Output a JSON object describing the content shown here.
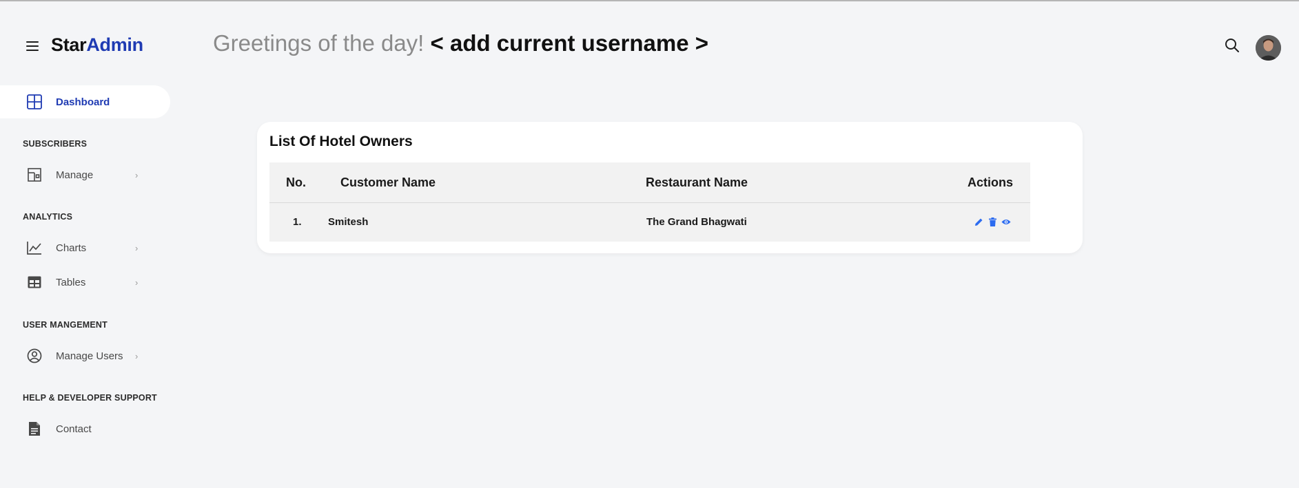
{
  "header": {
    "brand_part1": "Star",
    "brand_part2": "Admin",
    "greeting_prefix": "Greetings of the day!",
    "greeting_name": "< add current username >"
  },
  "sidebar": {
    "dashboard": "Dashboard",
    "sections": {
      "subscribers": "SUBSCRIBERS",
      "analytics": "ANALYTICS",
      "user_management": "USER MANGEMENT",
      "help": "HELP & DEVELOPER SUPPORT"
    },
    "items": {
      "manage": "Manage",
      "charts": "Charts",
      "tables": "Tables",
      "manage_users": "Manage Users",
      "contact": "Contact"
    },
    "chevron": "›"
  },
  "card": {
    "title": "List Of Hotel Owners",
    "columns": [
      "No.",
      "Customer Name",
      "Restaurant Name",
      "Actions"
    ],
    "rows": [
      {
        "no": "1.",
        "customer": "Smitesh",
        "restaurant": "The Grand Bhagwati"
      }
    ]
  },
  "icons": {
    "menu": "hamburger-icon",
    "search": "search-icon",
    "dashboard": "grid-icon",
    "manage": "layout-icon",
    "charts": "chart-line-icon",
    "tables": "table-icon",
    "manage_users": "user-circle-icon",
    "contact": "file-icon",
    "edit": "pencil-icon",
    "delete": "trash-icon",
    "view": "eye-icon"
  },
  "colors": {
    "accent": "#1f3bb3",
    "action_blue": "#2d6cf0",
    "background": "#f4f5f7"
  }
}
